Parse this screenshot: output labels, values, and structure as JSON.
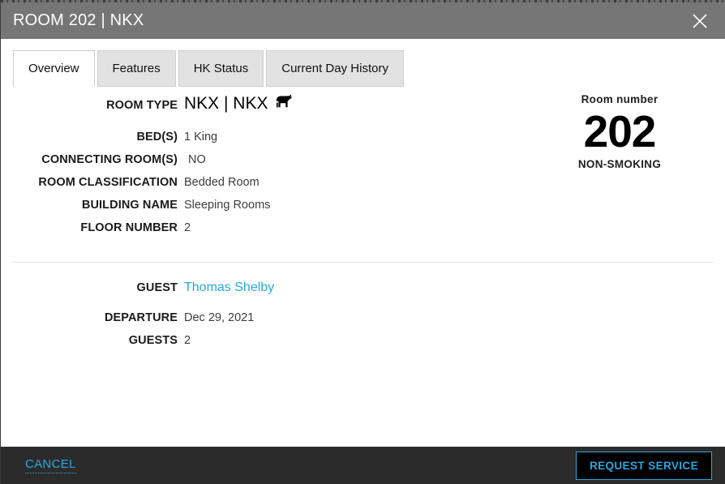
{
  "header": {
    "title": "ROOM 202 | NKX",
    "close_icon": "close-icon",
    "background": "#767676"
  },
  "tabs": [
    {
      "label": "Overview",
      "active": true
    },
    {
      "label": "Features",
      "active": false
    },
    {
      "label": "HK Status",
      "active": false
    },
    {
      "label": "Current Day History",
      "active": false
    }
  ],
  "room_details": [
    {
      "label": "ROOM TYPE",
      "value": "NKX | NKX",
      "icon": "pet-dog-icon"
    },
    {
      "label": "BED(S)",
      "value": "1 King"
    },
    {
      "label": "CONNECTING ROOM(S)",
      "value": "NO"
    },
    {
      "label": "ROOM CLASSIFICATION",
      "value": "Bedded Room"
    },
    {
      "label": "BUILDING NAME",
      "value": "Sleeping Rooms"
    },
    {
      "label": "FLOOR NUMBER",
      "value": "2"
    }
  ],
  "room_number_panel": {
    "label": "Room number",
    "value": "202",
    "smoking_status": "NON-SMOKING"
  },
  "guest_details": {
    "guest_label": "GUEST",
    "guest_name": "Thomas Shelby",
    "departure_label": "DEPARTURE",
    "departure_value": "Dec 29, 2021",
    "guests_label": "GUESTS",
    "guests_value": "2"
  },
  "footer": {
    "cancel_label": "CANCEL",
    "request_service_label": "REQUEST SERVICE",
    "accent_color": "#29a8dd",
    "background": "#2b2b2b"
  }
}
